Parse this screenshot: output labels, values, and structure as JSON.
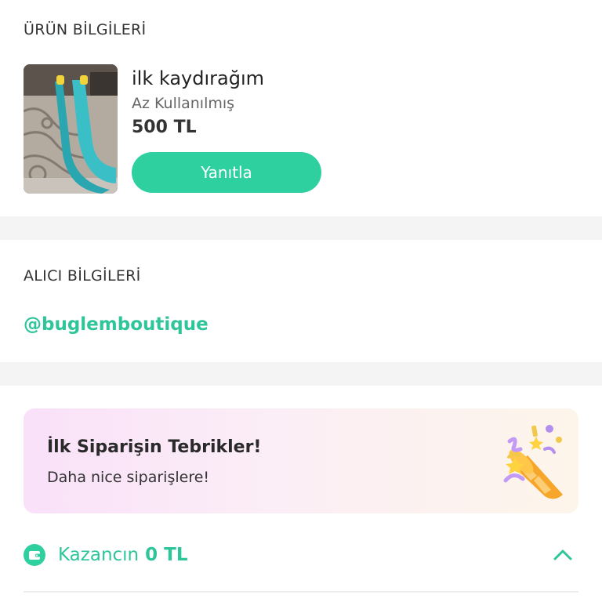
{
  "product": {
    "section_title": "ÜRÜN BİLGİLERİ",
    "image_icon": "product-photo-slide",
    "name": "ilk kaydırağım",
    "condition": "Az Kullanılmış",
    "price": "500 TL",
    "reply_label": "Yanıtla"
  },
  "buyer": {
    "section_title": "ALICI BİLGİLERİ",
    "handle": "@buglemboutique"
  },
  "congrats": {
    "title": "İlk Siparişin Tebrikler!",
    "subtitle": "Daha nice siparişlere!",
    "icon": "party-popper-icon"
  },
  "earnings": {
    "label": "Kazancın",
    "value": "0 TL",
    "icon": "wallet-icon",
    "toggle_icon": "chevron-up-icon"
  },
  "colors": {
    "accent": "#2fd0a0",
    "accent_text": "#2fc59a",
    "divider": "#f4f4f4"
  }
}
